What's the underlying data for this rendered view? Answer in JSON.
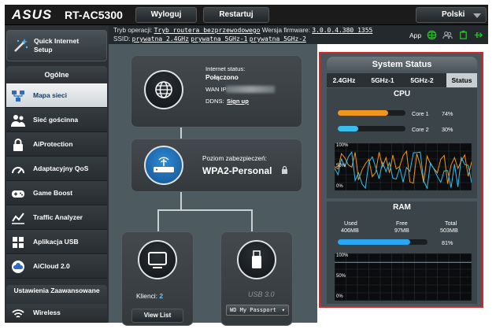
{
  "header": {
    "brand": "ASUS",
    "model": "RT-AC5300",
    "logout_label": "Wyloguj",
    "restart_label": "Restartuj",
    "language": "Polski"
  },
  "info": {
    "mode_label": "Tryb operacji:",
    "mode_value": "Tryb routera bezprzewodowego",
    "fw_label": "Wersja firmware:",
    "fw_value": "3.0.0.4.380_1355",
    "ssid_label": "SSID:",
    "ssids": [
      "prywatna_2.4GHz",
      "prywatna_5GHz-1",
      "prywatna_5GHz-2"
    ],
    "app_label": "App"
  },
  "sidebar": {
    "qis_label": "Quick Internet Setup",
    "general_header": "Ogólne",
    "items": [
      {
        "label": "Mapa sieci",
        "icon": "network-map-icon",
        "active": true
      },
      {
        "label": "Sieć gościnna",
        "icon": "guest-network-icon",
        "active": false
      },
      {
        "label": "AiProtection",
        "icon": "lock-icon",
        "active": false
      },
      {
        "label": "Adaptacyjny QoS",
        "icon": "speedometer-icon",
        "active": false
      },
      {
        "label": "Game Boost",
        "icon": "gamepad-icon",
        "active": false
      },
      {
        "label": "Traffic Analyzer",
        "icon": "chart-icon",
        "active": false
      },
      {
        "label": "Aplikacja USB",
        "icon": "usb-icon",
        "active": false
      },
      {
        "label": "AiCloud 2.0",
        "icon": "cloud-icon",
        "active": false
      }
    ],
    "advanced_header": "Ustawienia Zaawansowane",
    "advanced_items": [
      {
        "label": "Wireless",
        "icon": "wifi-icon"
      }
    ]
  },
  "map": {
    "internet_status_label": "Internet status:",
    "internet_status_value": "Połączono",
    "wan_ip_label": "WAN IP:",
    "ddns_label": "DDNS:",
    "ddns_link": "Sign up",
    "security_label": "Poziom zabezpieczeń:",
    "security_value": "WPA2-Personal",
    "clients_label": "Klienci:",
    "clients_value": "2",
    "view_list_label": "View List",
    "usb_label": "USB 3.0",
    "usb_device": "WD My Passport"
  },
  "system_status": {
    "title": "System Status",
    "tabs": [
      "2.4GHz",
      "5GHz-1",
      "5GHz-2",
      "Status"
    ],
    "active_tab": 3,
    "cpu": {
      "title": "CPU",
      "cores": [
        {
          "label": "Core 1",
          "percent": "74%",
          "value": 74,
          "color": "#f0961e"
        },
        {
          "label": "Core 2",
          "percent": "30%",
          "value": 30,
          "color": "#38bff0"
        }
      ],
      "axis": [
        "100%",
        "50%",
        "0%"
      ]
    },
    "ram": {
      "title": "RAM",
      "used_label": "Used",
      "used_value": "406MB",
      "free_label": "Free",
      "free_value": "97MB",
      "total_label": "Total",
      "total_value": "503MB",
      "percent": "81%",
      "value": 81,
      "axis": [
        "100%",
        "50%",
        "0%"
      ]
    }
  }
}
